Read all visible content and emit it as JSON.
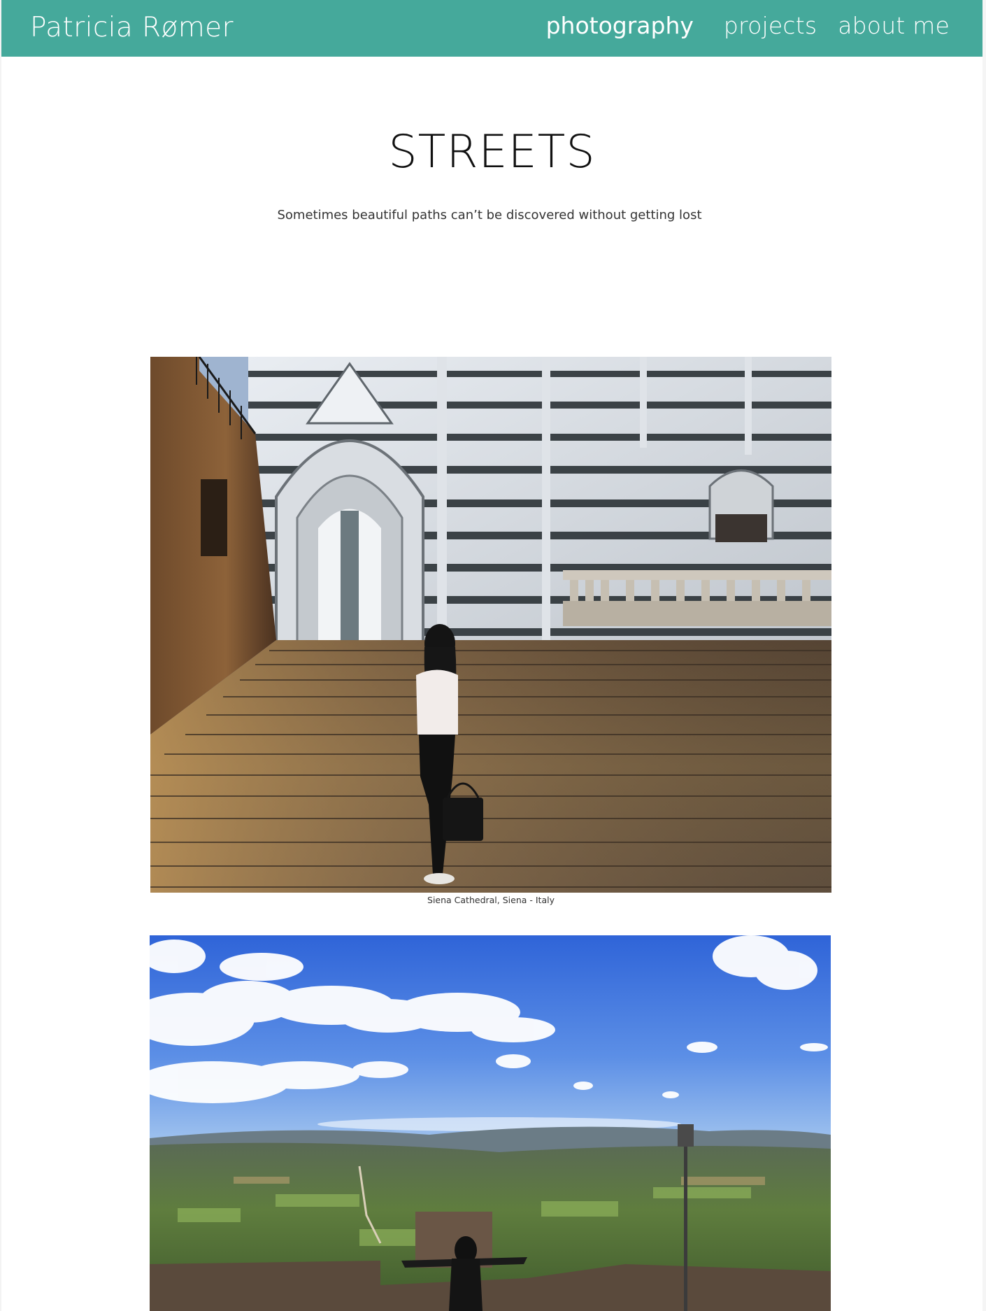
{
  "header": {
    "brand": "Patricia Rømer",
    "nav": [
      {
        "label": "photography",
        "active": true
      },
      {
        "label": "projects",
        "active": false
      },
      {
        "label": "about me",
        "active": false
      }
    ],
    "accent_color": "#45a99b"
  },
  "main": {
    "title": "STREETS",
    "subtitle": "Sometimes beautiful paths can’t be discovered without getting lost",
    "photos": [
      {
        "caption": "Siena Cathedral, Siena - Italy"
      },
      {
        "caption": ""
      }
    ]
  }
}
